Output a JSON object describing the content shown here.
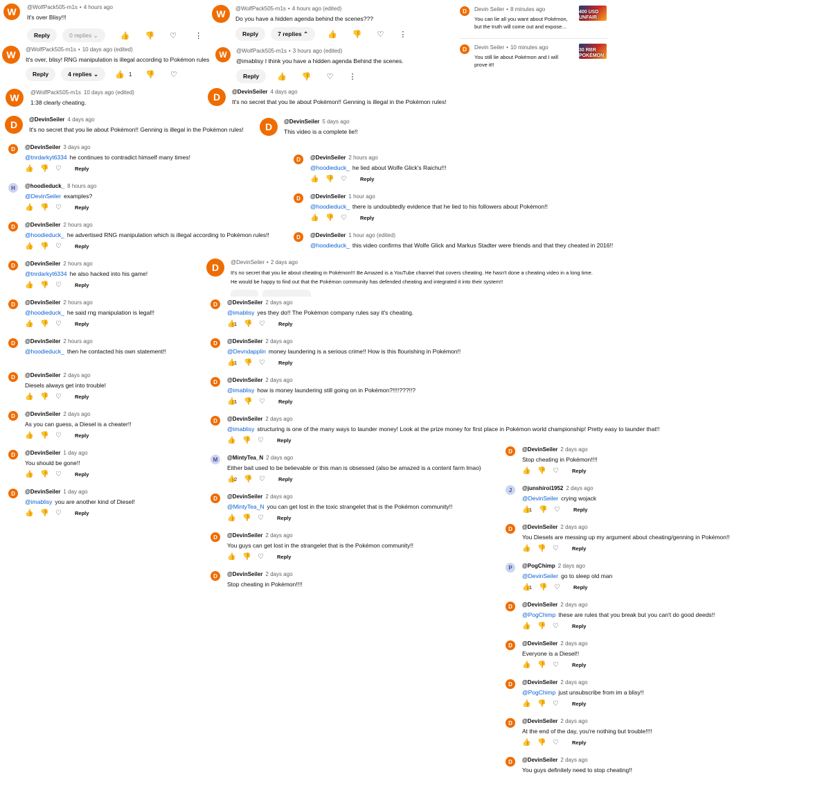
{
  "colors": {
    "avatar": "#ef6c00",
    "mention": "#065fd4",
    "muted": "#606060"
  },
  "top": {
    "c1": {
      "author": "@WolfPack505-m1s",
      "time": "4 hours ago",
      "text": "It's over Blisy!!!",
      "reply": "Reply",
      "replies": "0 replies"
    },
    "c2": {
      "author": "@WolfPack505-m1s",
      "time": "10 days ago (edited)",
      "text": "It's over, blisy! RNG manipulation is illegal according to Pokémon rules",
      "reply": "Reply",
      "replies": "4 replies",
      "likes": "1"
    },
    "c3": {
      "author": "@WolfPack505-m1s",
      "time": "10 days ago (edited)",
      "text": "1:38 clearly cheating."
    },
    "c4": {
      "author": "@WolfPack505-m1s",
      "time": "4 hours ago (edited)",
      "text": "Do you have a hidden agenda behind the scenes???",
      "reply": "Reply",
      "replies": "7 replies"
    },
    "c5": {
      "author": "@WolfPack505-m1s",
      "time": "3 hours ago (edited)",
      "text": "@imablisy I think you have a hidden agenda Behind the scenes.",
      "reply": "Reply"
    },
    "c6": {
      "author": "@DevinSeiler",
      "time": "4 days ago",
      "text": "It's no secret that you lie about Pokémon!! Genning is illegal in the Pokémon rules!"
    },
    "n1": {
      "author": "Devin Seiler",
      "time": "8 minutes ago",
      "text1": "You can lie all you want about Pokémon,",
      "text2": "but the truth will come out and expose...",
      "thumb": "400 USD UNFAIR"
    },
    "n2": {
      "author": "Devin Seiler",
      "time": "10 minutes ago",
      "text1": "You still lie about Pokémon and I will",
      "text2": "prove it!!",
      "thumb": "30 RBR POKÉMON"
    }
  },
  "leftMain": {
    "author": "@DevinSeiler",
    "time": "4 days ago",
    "text": "It's no secret that you lie about Pokémon!! Genning is illegal in the Pokémon rules!"
  },
  "left": [
    {
      "author": "@DevinSeiler",
      "time": "3 days ago",
      "mention": "@tnrdarkyt6334",
      "text": "he continues to contradict himself many times!",
      "reply": "Reply",
      "avatar": "D"
    },
    {
      "author": "@hoodieduck_",
      "time": "8 hours ago",
      "mention": "@DevinSeiler",
      "text": "examples?",
      "reply": "Reply",
      "avatar": "H"
    },
    {
      "author": "@DevinSeiler",
      "time": "2 hours ago",
      "mention": "@hoodieduck_",
      "text": "he advertised RNG manipulation which is illegal according to Pokémon rules!!",
      "reply": "Reply",
      "avatar": "D"
    },
    {
      "author": "@DevinSeiler",
      "time": "2 hours ago",
      "mention": "@tnrdarkyt6334",
      "text": "he also hacked into his game!",
      "reply": "Reply",
      "avatar": "D"
    },
    {
      "author": "@DevinSeiler",
      "time": "2 hours ago",
      "mention": "@hoodieduck_",
      "text": "he said rng manipulation is legal!!",
      "reply": "Reply",
      "avatar": "D"
    },
    {
      "author": "@DevinSeiler",
      "time": "2 hours ago",
      "mention": "@hoodieduck_",
      "text": "then he contacted his own statement!!",
      "reply": "",
      "avatar": "D"
    },
    {
      "author": "@DevinSeiler",
      "time": "2 days ago",
      "mention": "",
      "text": "Diesels always get into trouble!",
      "reply": "Reply",
      "avatar": "D"
    },
    {
      "author": "@DevinSeiler",
      "time": "2 days ago",
      "mention": "",
      "text": "As you can guess, a Diesel is a cheater!!",
      "reply": "Reply",
      "avatar": "D"
    },
    {
      "author": "@DevinSeiler",
      "time": "1 day ago",
      "mention": "",
      "text": "You should be gone!!",
      "reply": "Reply",
      "avatar": "D"
    },
    {
      "author": "@DevinSeiler",
      "time": "1 day ago",
      "mention": "@imablisy",
      "text": "you are another kind of Diesel!",
      "reply": "Reply",
      "avatar": "D"
    }
  ],
  "midMain": {
    "author": "@DevinSeiler",
    "time": "5 days ago",
    "text": "This video is a complete lie!!"
  },
  "mid": [
    {
      "author": "@DevinSeiler",
      "time": "2 hours ago",
      "mention": "@hoodieduck_",
      "text": "he lied about Wolfe Glick's Raichu!!!",
      "reply": "Reply"
    },
    {
      "author": "@DevinSeiler",
      "time": "1 hour ago",
      "mention": "@hoodieduck_",
      "text": "there is undoubtedly evidence that he lied to his followers about Pokémon!!",
      "reply": "Reply"
    },
    {
      "author": "@DevinSeiler",
      "time": "1 hour ago (edited)",
      "mention": "@hoodieduck_",
      "text": "this video confirms that Wolfe Glick and Markus Stadter were friends and that they cheated in 2016!!",
      "reply": ""
    }
  ],
  "centerMain": {
    "author": "@DevinSeiler",
    "time": "2 days ago",
    "line1": "It's no secret that you lie about cheating in Pokémon!!! Be Amazed is a YouTube channel that covers cheating. He hasn't done a cheating video in a long time.",
    "line2": "He would be happy to find out that the Pokémon community has defended cheating and integrated it into their system!!"
  },
  "center": [
    {
      "author": "@DevinSeiler",
      "time": "2 days ago",
      "mention": "@imablisy",
      "text": "yes they do!! The Pokémon company rules say it's cheating.",
      "likes": "1",
      "reply": "Reply",
      "avatar": "D"
    },
    {
      "author": "@DevinSeiler",
      "time": "2 days ago",
      "mention": "@Devndapplin",
      "text": "money laundering is a serious crime!! How is this flourishing in Pokémon!!",
      "likes": "1",
      "reply": "Reply",
      "avatar": "D"
    },
    {
      "author": "@DevinSeiler",
      "time": "2 days ago",
      "mention": "@imablisy",
      "text": "how is money laundering still going on in Pokémon?!!!!???!!?",
      "likes": "1",
      "reply": "Reply",
      "avatar": "D"
    },
    {
      "author": "@DevinSeiler",
      "time": "2 days ago",
      "mention": "@imablisy",
      "text": "structuring is one of the many ways to launder money! Look at the prize money for first place in Pokémon world championship! Pretty easy to launder that!!",
      "likes": "",
      "reply": "Reply",
      "avatar": "D"
    },
    {
      "author": "@MintyTea_N",
      "time": "2 days ago",
      "mention": "",
      "text": "Either bait used to be believable or this man is obsessed (also be amazed is a content farm lmao)",
      "likes": "2",
      "reply": "Reply",
      "avatar": "M"
    },
    {
      "author": "@DevinSeiler",
      "time": "2 days ago",
      "mention": "@MintyTea_N",
      "text": "you can get lost in the toxic strangelet that is the Pokémon community!!",
      "likes": "",
      "reply": "Reply",
      "avatar": "D"
    },
    {
      "author": "@DevinSeiler",
      "time": "2 days ago",
      "mention": "",
      "text": "You guys can get lost in the strangelet that is the Pokémon community!!",
      "likes": "",
      "reply": "Reply",
      "avatar": "D"
    },
    {
      "author": "@DevinSeiler",
      "time": "2 days ago",
      "mention": "",
      "text": "Stop cheating in Pokémon!!!!",
      "likes": "",
      "reply": "",
      "avatar": "D"
    }
  ],
  "right": [
    {
      "author": "@DevinSeiler",
      "time": "2 days ago",
      "mention": "",
      "text": "Stop cheating in Pokémon!!!!",
      "likes": "",
      "reply": "Reply",
      "avatar": "D"
    },
    {
      "author": "@junshiroi1952",
      "time": "2 days ago",
      "mention": "@DevinSeiler",
      "text": "crying wojack",
      "likes": "1",
      "reply": "Reply",
      "avatar": "J"
    },
    {
      "author": "@DevinSeiler",
      "time": "2 days ago",
      "mention": "",
      "text": "You Diesels are messing up my argument about cheating/genning in Pokémon!!",
      "likes": "",
      "reply": "Reply",
      "avatar": "D"
    },
    {
      "author": "@PogChimp",
      "time": "2 days ago",
      "mention": "@DevinSeiler",
      "text": "go to sleep old man",
      "likes": "1",
      "reply": "Reply",
      "avatar": "P"
    },
    {
      "author": "@DevinSeiler",
      "time": "2 days ago",
      "mention": "@PogChimp",
      "text": "these are rules that you break but you can't do good deeds!!",
      "likes": "",
      "reply": "Reply",
      "avatar": "D"
    },
    {
      "author": "@DevinSeiler",
      "time": "2 days ago",
      "mention": "",
      "text": "Everyone is a Diesel!!",
      "likes": "",
      "reply": "Reply",
      "avatar": "D"
    },
    {
      "author": "@DevinSeiler",
      "time": "2 days ago",
      "mention": "@PogChimp",
      "text": "just unsubscribe from im a blisy!!",
      "likes": "",
      "reply": "Reply",
      "avatar": "D"
    },
    {
      "author": "@DevinSeiler",
      "time": "2 days ago",
      "mention": "",
      "text": "At the end of the day, you're nothing but trouble!!!!",
      "likes": "",
      "reply": "Reply",
      "avatar": "D"
    },
    {
      "author": "@DevinSeiler",
      "time": "2 days ago",
      "mention": "",
      "text": "You guys definitely need to stop cheating!!",
      "likes": "",
      "reply": "",
      "avatar": "D"
    }
  ]
}
